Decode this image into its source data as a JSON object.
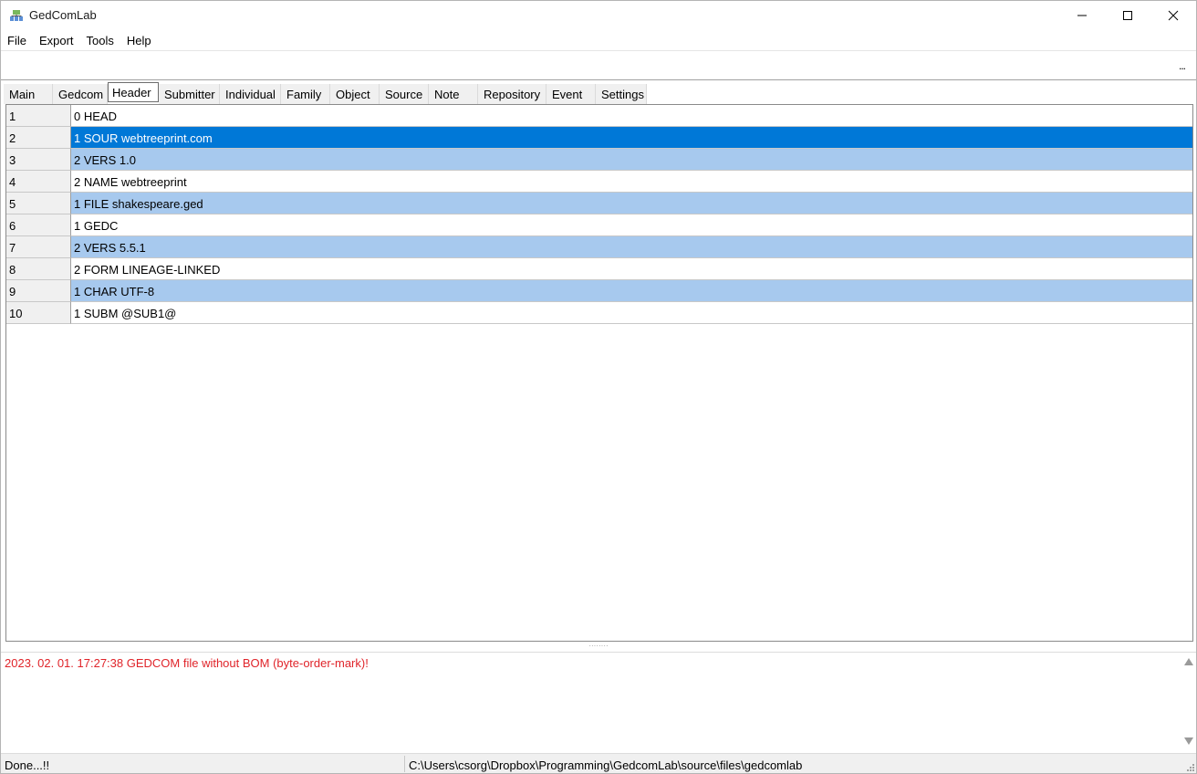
{
  "window": {
    "title": "GedComLab"
  },
  "menu": [
    "File",
    "Export",
    "Tools",
    "Help"
  ],
  "toolbar": {
    "overflow_label": "..."
  },
  "tabs": [
    "Main",
    "Gedcom",
    "Header",
    "Submitter",
    "Individual",
    "Family",
    "Object",
    "Source",
    "Note",
    "Repository",
    "Event",
    "Settings"
  ],
  "active_tab": "Header",
  "grid": {
    "rows": [
      {
        "num": "1",
        "text": "0 HEAD",
        "state": "normal"
      },
      {
        "num": "2",
        "text": "1 SOUR webtreeprint.com",
        "state": "selected"
      },
      {
        "num": "3",
        "text": "2 VERS 1.0",
        "state": "highlighted"
      },
      {
        "num": "4",
        "text": "2 NAME webtreeprint",
        "state": "normal"
      },
      {
        "num": "5",
        "text": "1 FILE shakespeare.ged",
        "state": "highlighted"
      },
      {
        "num": "6",
        "text": "1 GEDC",
        "state": "normal"
      },
      {
        "num": "7",
        "text": "2 VERS 5.5.1",
        "state": "highlighted"
      },
      {
        "num": "8",
        "text": "2 FORM LINEAGE-LINKED",
        "state": "normal"
      },
      {
        "num": "9",
        "text": "1 CHAR UTF-8",
        "state": "highlighted"
      },
      {
        "num": "10",
        "text": "1 SUBM @SUB1@",
        "state": "normal"
      }
    ]
  },
  "log": {
    "lines": [
      "2023. 02. 01. 17:27:38 GEDCOM file without BOM (byte-order-mark)!"
    ],
    "color": "#e0242a"
  },
  "status": {
    "message": "Done...!!",
    "path": "C:\\Users\\csorg\\Dropbox\\Programming\\GedcomLab\\source\\files\\gedcomlab"
  },
  "colors": {
    "selected_row": "#0078d7",
    "highlighted_row": "#a7c9ee"
  }
}
